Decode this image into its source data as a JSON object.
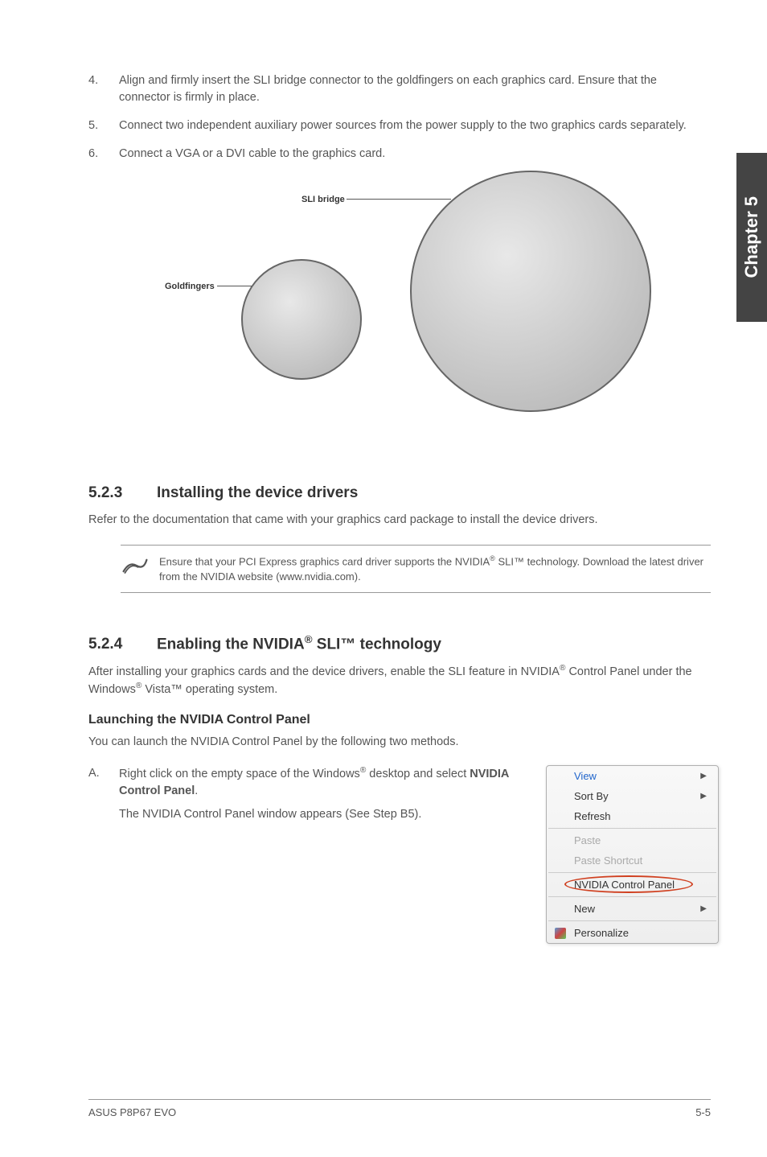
{
  "side_tab": "Chapter 5",
  "steps": [
    {
      "num": "4.",
      "text": "Align and firmly insert the SLI bridge connector to the goldfingers on each graphics card. Ensure that the connector is firmly in place."
    },
    {
      "num": "5.",
      "text": "Connect two independent auxiliary power sources from the power supply to the two graphics cards separately."
    },
    {
      "num": "6.",
      "text": "Connect a VGA or a DVI cable to the graphics card."
    }
  ],
  "diagram": {
    "sli_bridge": "SLI bridge",
    "goldfingers": "Goldfingers"
  },
  "section_523": {
    "num": "5.2.3",
    "title": "Installing the device drivers",
    "body": "Refer to the documentation that came with your graphics card package to install the device drivers.",
    "note_p1": "Ensure that your PCI Express graphics card driver supports the NVIDIA",
    "note_p2": " SLI™ technology. Download the latest driver from the NVIDIA website (www.nvidia.com)."
  },
  "section_524": {
    "num": "5.2.4",
    "title_p1": "Enabling the NVIDIA",
    "title_p2": " SLI™ technology",
    "body_p1": "After installing your graphics cards and the device drivers, enable the SLI feature in NVIDIA",
    "body_p2": " Control Panel under the Windows",
    "body_p3": " Vista™ operating system.",
    "subheading": "Launching the NVIDIA Control Panel",
    "intro": "You can launch the NVIDIA Control Panel by the following two methods.",
    "item_a_letter": "A.",
    "item_a_p1": "Right click on the empty space of the Windows",
    "item_a_p2": " desktop and select ",
    "item_a_bold": "NVIDIA Control Panel",
    "item_a_p3": ".",
    "item_a_line2": "The NVIDIA Control Panel window appears (See Step B5)."
  },
  "menu": {
    "view": "View",
    "sortby": "Sort By",
    "refresh": "Refresh",
    "paste": "Paste",
    "paste_shortcut": "Paste Shortcut",
    "nvidia": "NVIDIA Control Panel",
    "new": "New",
    "personalize": "Personalize"
  },
  "footer": {
    "left": "ASUS P8P67 EVO",
    "right": "5-5"
  },
  "reg": "®"
}
